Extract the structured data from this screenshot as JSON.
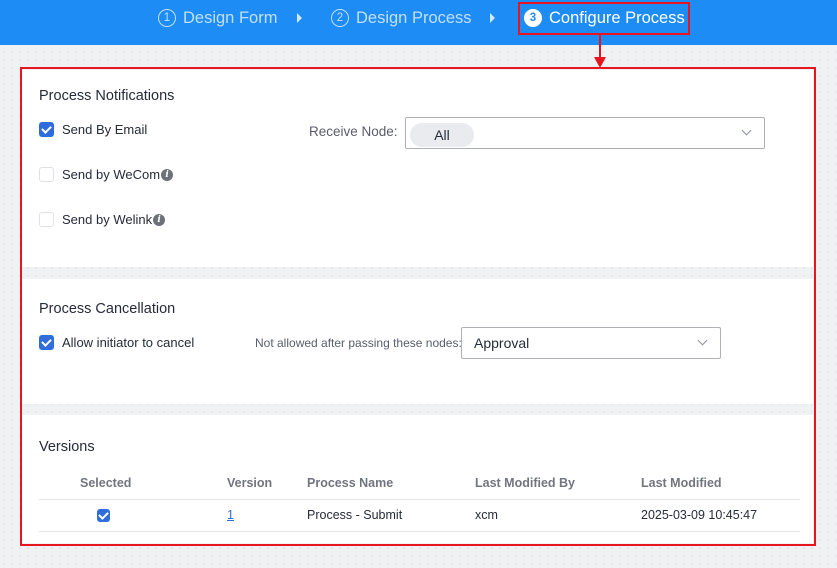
{
  "steps": [
    {
      "number": "1",
      "label": "Design Form"
    },
    {
      "number": "2",
      "label": "Design Process"
    },
    {
      "number": "3",
      "label": "Configure Process"
    }
  ],
  "notifications": {
    "title": "Process Notifications",
    "options": [
      {
        "label": "Send By Email",
        "checked": true,
        "info": false
      },
      {
        "label": "Send by WeCom",
        "checked": false,
        "info": true
      },
      {
        "label": "Send by Welink",
        "checked": false,
        "info": true
      }
    ],
    "receive_node_label": "Receive Node:",
    "receive_node_tag": "All"
  },
  "cancellation": {
    "title": "Process Cancellation",
    "allow_label": "Allow initiator to cancel",
    "allow_checked": true,
    "nodes_label": "Not allowed after passing these nodes:",
    "nodes_value": "Approval"
  },
  "versions": {
    "title": "Versions",
    "columns": [
      "Selected",
      "Version",
      "Process Name",
      "Last Modified By",
      "Last Modified"
    ],
    "rows": [
      {
        "selected": true,
        "version": "1",
        "process_name": "Process - Submit",
        "modified_by": "xcm",
        "modified": "2025-03-09 10:45:47"
      }
    ]
  },
  "colors": {
    "header_bg": "#1e8cf5",
    "accent": "#2f6ddd",
    "highlight": "#e8141f"
  },
  "icons": {
    "info": "info-icon",
    "check": "checkmark-icon",
    "chevron": "chevron-down-icon",
    "step_arrow": "caret-right-icon"
  }
}
